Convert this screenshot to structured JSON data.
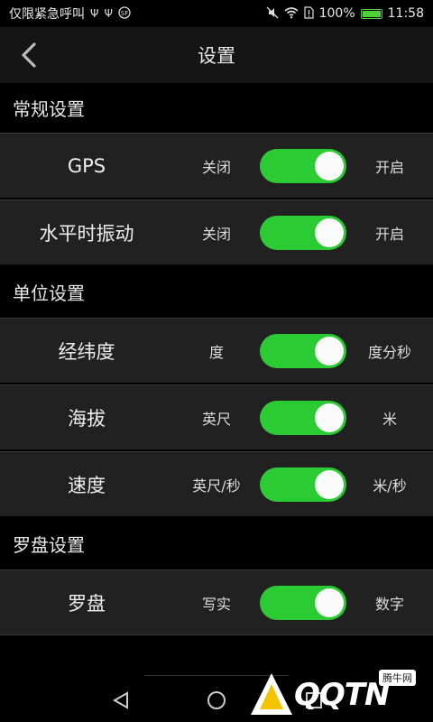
{
  "status_bar": {
    "left_text": "仅限紧急呼叫",
    "battery": "100%",
    "battery_level": 1.0,
    "time": "11:58",
    "icons": [
      "usb-icon",
      "usb-icon",
      "emergency-icon",
      "mute-icon",
      "wifi-icon",
      "sim-alert-icon",
      "battery-icon"
    ]
  },
  "header": {
    "title": "设置",
    "back_icon": "chevron-left-icon"
  },
  "sections": [
    {
      "title": "常规设置",
      "rows": [
        {
          "label": "GPS",
          "off_label": "关闭",
          "on_label": "开启",
          "state": "on"
        },
        {
          "label": "水平时振动",
          "off_label": "关闭",
          "on_label": "开启",
          "state": "on"
        }
      ]
    },
    {
      "title": "单位设置",
      "rows": [
        {
          "label": "经纬度",
          "off_label": "度",
          "on_label": "度分秒",
          "state": "on"
        },
        {
          "label": "海拔",
          "off_label": "英尺",
          "on_label": "米",
          "state": "on"
        },
        {
          "label": "速度",
          "off_label": "英尺/秒",
          "on_label": "米/秒",
          "state": "on"
        }
      ]
    },
    {
      "title": "罗盘设置",
      "rows": [
        {
          "label": "罗盘",
          "off_label": "写实",
          "on_label": "数字",
          "state": "on"
        }
      ]
    }
  ],
  "nav": {
    "back_icon": "nav-back-triangle-icon",
    "home_icon": "nav-home-circle-icon",
    "recent_icon": "nav-recent-square-icon"
  },
  "watermark": {
    "text": "QQTN",
    "badge": "腾牛网"
  },
  "colors": {
    "toggle_on": "#2bcc33",
    "row_bg": "#212121",
    "header_bg": "#151515",
    "battery": "#4cd137"
  }
}
